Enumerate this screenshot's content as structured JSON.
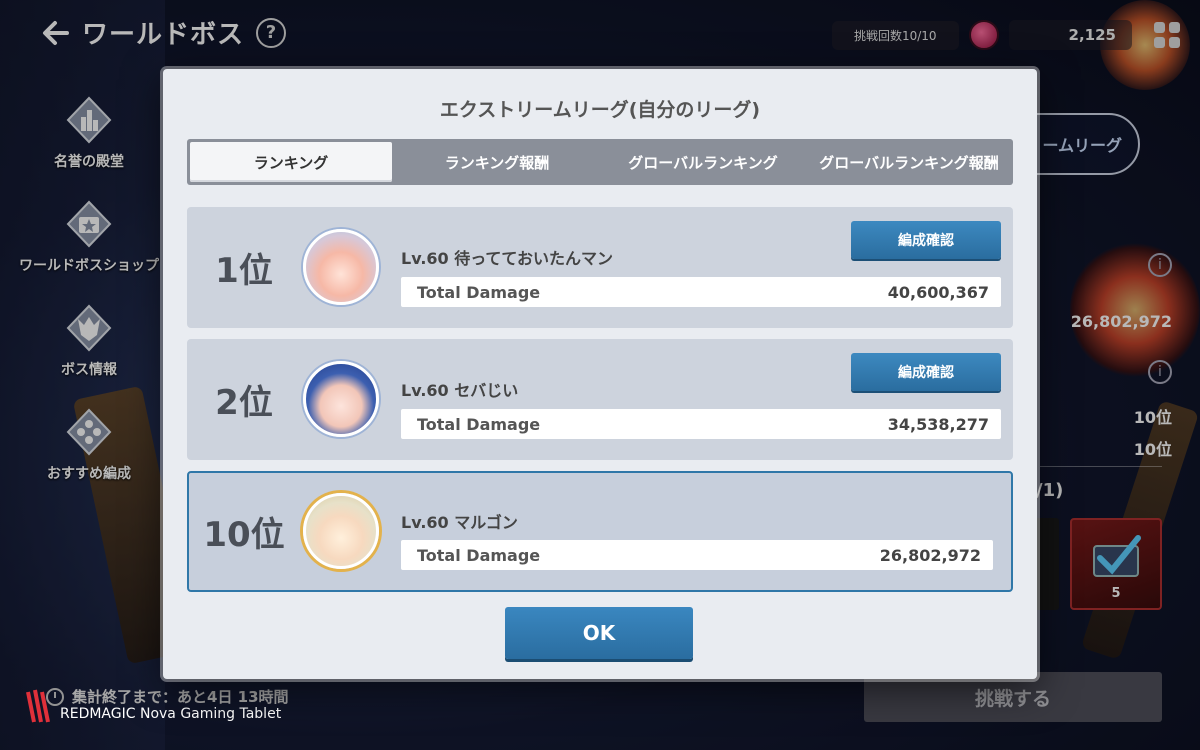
{
  "header": {
    "title": "ワールドボス",
    "help": "?"
  },
  "top_bar": {
    "tries": "挑戦回数10/10",
    "currency_value": "2,125"
  },
  "sidebar": {
    "items": [
      {
        "label": "名誉の殿堂"
      },
      {
        "label": "ワールドボスショップ"
      },
      {
        "label": "ボス情報"
      },
      {
        "label": "おすすめ編成"
      }
    ]
  },
  "background_panel": {
    "league_pill": "ームリーグ",
    "total_damage": "26,802,972",
    "rank_a": "10位",
    "rank_b": "10位",
    "fraction": "/1)",
    "reward_count": "5",
    "challenge_button": "挑戦する"
  },
  "footer": {
    "timer": "集計終了まで：あと4日 13時間",
    "watermark": "REDMAGIC Nova Gaming Tablet"
  },
  "modal": {
    "title": "エクストリームリーグ(自分のリーグ)",
    "tabs": [
      {
        "label": "ランキング",
        "active": true
      },
      {
        "label": "ランキング報酬",
        "active": false
      },
      {
        "label": "グローバルランキング",
        "active": false
      },
      {
        "label": "グローバルランキング報酬",
        "active": false
      }
    ],
    "rankings": [
      {
        "rank": "1位",
        "name": "Lv.60 待ってておいたんマン",
        "damage_label": "Total Damage",
        "damage": "40,600,367",
        "formation_button": "編成確認"
      },
      {
        "rank": "2位",
        "name": "Lv.60 セバじい",
        "damage_label": "Total Damage",
        "damage": "34,538,277",
        "formation_button": "編成確認"
      },
      {
        "rank": "10位",
        "name": "Lv.60 マルゴン",
        "damage_label": "Total Damage",
        "damage": "26,802,972"
      }
    ],
    "ok_button": "OK"
  },
  "colors": {
    "accent_blue": "#2f77a8",
    "modal_bg": "#e9ecf1",
    "row_bg": "#cdd3dd"
  }
}
